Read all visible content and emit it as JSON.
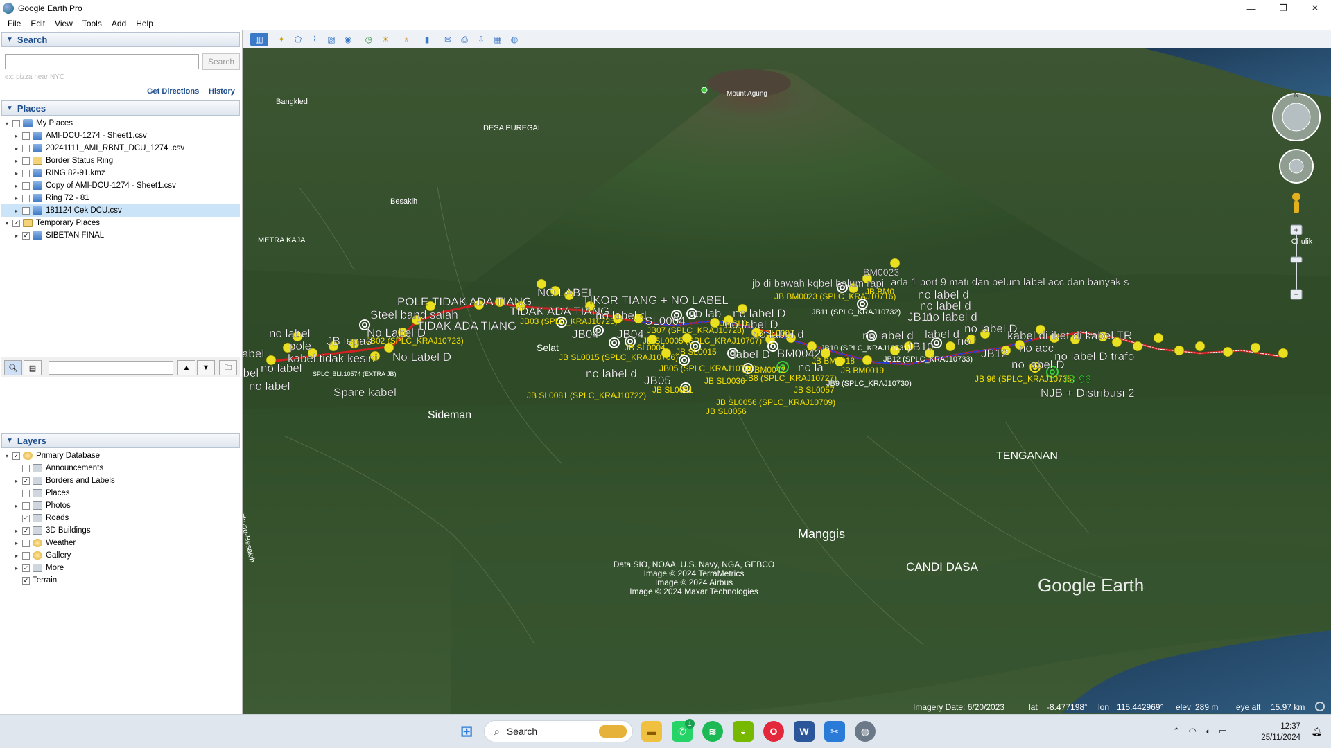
{
  "window": {
    "title": "Google Earth Pro",
    "minimize": "—",
    "maximize": "❐",
    "close": "✕"
  },
  "menu": [
    "File",
    "Edit",
    "View",
    "Tools",
    "Add",
    "Help"
  ],
  "search": {
    "header": "Search",
    "placeholder": "",
    "button": "Search",
    "hint": "ex: pizza near NYC",
    "get_directions": "Get Directions",
    "history": "History"
  },
  "places": {
    "header": "Places",
    "items": [
      {
        "label": "My Places",
        "level": 0,
        "checked": false,
        "icon": "layer-icon",
        "expander": "▾"
      },
      {
        "label": "AMI-DCU-1274 - Sheet1.csv",
        "level": 1,
        "checked": false,
        "icon": "layer-icon",
        "expander": "▸"
      },
      {
        "label": "20241111_AMI_RBNT_DCU_1274 .csv",
        "level": 1,
        "checked": false,
        "icon": "layer-icon",
        "expander": "▸"
      },
      {
        "label": "Border Status Ring",
        "level": 1,
        "checked": false,
        "icon": "folder-icon",
        "expander": "▸"
      },
      {
        "label": "RING 82-91.kmz",
        "level": 1,
        "checked": false,
        "icon": "layer-icon",
        "expander": "▸"
      },
      {
        "label": "Copy of AMI-DCU-1274 - Sheet1.csv",
        "level": 1,
        "checked": false,
        "icon": "layer-icon",
        "expander": "▸"
      },
      {
        "label": "Ring 72 - 81",
        "level": 1,
        "checked": false,
        "icon": "layer-icon",
        "expander": "▸"
      },
      {
        "label": "181124 Cek DCU.csv",
        "level": 1,
        "checked": false,
        "icon": "layer-icon",
        "expander": "▸",
        "selected": true
      },
      {
        "label": "Temporary Places",
        "level": 0,
        "checked": true,
        "icon": "folder-icon",
        "expander": "▾"
      },
      {
        "label": "SIBETAN FINAL",
        "level": 1,
        "checked": true,
        "icon": "layer-icon",
        "expander": "▸"
      }
    ]
  },
  "layers": {
    "header": "Layers",
    "items": [
      {
        "label": "Primary Database",
        "level": 0,
        "checked": true,
        "icon": "database-icon",
        "expander": "▾"
      },
      {
        "label": "Announcements",
        "level": 1,
        "checked": false,
        "icon": "box-icon",
        "expander": ""
      },
      {
        "label": "Borders and Labels",
        "level": 1,
        "checked": true,
        "icon": "flag-icon",
        "expander": "▸"
      },
      {
        "label": "Places",
        "level": 1,
        "checked": false,
        "icon": "box-icon",
        "expander": ""
      },
      {
        "label": "Photos",
        "level": 1,
        "checked": false,
        "icon": "box-icon",
        "expander": "▸"
      },
      {
        "label": "Roads",
        "level": 1,
        "checked": true,
        "icon": "box-icon",
        "expander": ""
      },
      {
        "label": "3D Buildings",
        "level": 1,
        "checked": true,
        "icon": "building-icon",
        "expander": "▸"
      },
      {
        "label": "Weather",
        "level": 1,
        "checked": false,
        "icon": "sun-icon",
        "expander": "▸"
      },
      {
        "label": "Gallery",
        "level": 1,
        "checked": false,
        "icon": "star-icon",
        "expander": "▸"
      },
      {
        "label": "More",
        "level": 1,
        "checked": true,
        "icon": "box-icon",
        "expander": "▸"
      },
      {
        "label": "Terrain",
        "level": 1,
        "checked": true,
        "icon": "",
        "expander": ""
      }
    ]
  },
  "map": {
    "places": {
      "bangkled": "Bangkled",
      "desa_puregai": "DESA PUREGAI",
      "mount_agung": "Mount Agung",
      "besakih": "Besakih",
      "metra_kaja": "METRA KAJA",
      "sideman": "Sideman",
      "selat": "Selat",
      "manggis": "Manggis",
      "candi_dasa": "CANDI DASA",
      "tenganan": "TENGANAN",
      "klungkung": "Klungkung-Besakih"
    },
    "white_labels": {
      "no_label_left": "no label",
      "o_label": "o label",
      "abel": "abel",
      "pole": "pole",
      "jb_lepas": "JB lepas",
      "kabel_tidak_kesini": "kabel tidak kesini",
      "no_label_2": "no label",
      "no_label_3": "no label",
      "no_label_d_1": "No Label D",
      "no_label_d_2": "No Label D",
      "spare_kabel": "Spare kabel",
      "steel_band": "Steel band salah",
      "pole_tidak": "POLE",
      "tidak_ada_tiang_1": "TIDAK ADA TIANG",
      "tidak_ada_tiang_2": "TIDAK ADA TIANG",
      "tidak_ada_tiang_3": "TIDAK ADA TIANG",
      "no_label_top": "NO LABEL",
      "tikor": "TIKOR TIANG + NO LABEL",
      "no_label_d_3": "no label d",
      "sl0004": "SL0004",
      "jb04_1": "JB04",
      "jb04_2": "JB04",
      "no_label_d_4": "no label d",
      "jb05": "JB05",
      "no_lab": "no lab",
      "label_d": "label D",
      "no_label_d_5": "no label D",
      "no_label_d_6": "no label D",
      "no_label_d_7": "no label d",
      "bm0042": "BM0042",
      "no_la": "no la",
      "bm0023": "BM0023",
      "jb_bawah": "jb di bawah kqbel belum rapi",
      "ada_1_port": "ada 1 port 9 mati  dan belum label acc dan banyak s",
      "no_label_d_8": "no label d",
      "no_label_d_9": "no label d",
      "jb11": "JB11",
      "no_label_d_10": "no label d",
      "no_label_11": "no label d",
      "label_d2": "label d",
      "jb10": "JB10",
      "no_label_d_12": "no label D",
      "no_label_13": "no l",
      "jb12": "JB12",
      "kabel_iket": "kabel di iket di kabel TR",
      "no_acc": "no acc",
      "no_label_d_trafo": "no label D trafo",
      "no_label_d_14": "no label D",
      "njb": "NJB + Distribusi 2"
    },
    "yellow_labels": {
      "jb02": "JB02 (SPLC_KRAJ10723)",
      "jb03": "JB03 (SPLC_KRAJ10725)",
      "jb07": "JB07 (SPLC_KRAJ10728)",
      "jb_sl0005": "JB SL0005 (SPLC_KRAJ10707)",
      "jb_sl0004": "JB SL0004",
      "jb_sl0015": "JB SL0015 (SPLC_KRAJ10706)",
      "jb_sl0015b": "JB SL0015",
      "jb05_splc": "JB05 (SPLC_KRAJ10726)",
      "jb_sl0081_splc": "JB SL0081 (SPLC_KRAJ10722)",
      "jb_sl0081": "JB SL0081",
      "jb_sl0036": "JB SL0036",
      "jb_sl0056_splc": "JB SL0056 (SPLC_KRAJ10709)",
      "jb_sl0056": "JB SL0056",
      "jb_bm0042": "JB BM0042",
      "jb8": "JB8 (SPLC_KRAJ10727)",
      "jb_sl0057": "JB SL0057",
      "jb_sl0007": "JB SL0007",
      "jb_sl0": "JB SL0",
      "jb_bm0023": "JB BM0023 (SPLC_KRAJ10716)",
      "jb_bm0": "JB BM0",
      "jb11_splc": "JB11 (SPLC_KRAJ10732)",
      "jb10_splc": "JB10 (SPLC_KRAJ10731)",
      "jb_bm0018": "JB BM0018",
      "jb_bm0019": "JB BM0019",
      "jb9": "JB9 (SPLC_KRAJ10730)",
      "jb12_splc": "JB12 (SPLC_KRAJ10733)",
      "jb96_splc": "JB 96 (SPLC_KRAJ10735)",
      "splc_bli": "SPLC_BLI.10574 (EXTRA JB)",
      "jb96": "JB 96"
    },
    "attribution": [
      "Data SIO, NOAA, U.S. Navy, NGA, GEBCO",
      "Image © 2024 TerraMetrics",
      "Image © 2024 Airbus",
      "Image © 2024 Maxar Technologies"
    ],
    "logo": "Google Earth",
    "status": {
      "imagery_date": "Imagery Date: 6/20/2023",
      "lat_label": "lat",
      "lat": "-8.477198°",
      "lon_label": "lon",
      "lon": "115.442969°",
      "elev_label": "elev",
      "elev": "289 m",
      "eye_alt_label": "eye alt",
      "eye_alt": "15.97 km"
    },
    "zoom_tooltip": "Chulik",
    "compass_n": "N"
  },
  "taskbar": {
    "search_label": "Search",
    "time": "12:37",
    "date": "25/11/2024",
    "whatsapp_badge": "1"
  },
  "colors": {
    "route_red": "#d02020",
    "route_blue": "#1a3fd6",
    "marker_yellow": "#e8e020",
    "label_yellow": "#f4e000",
    "selection": "#cce4f7"
  }
}
